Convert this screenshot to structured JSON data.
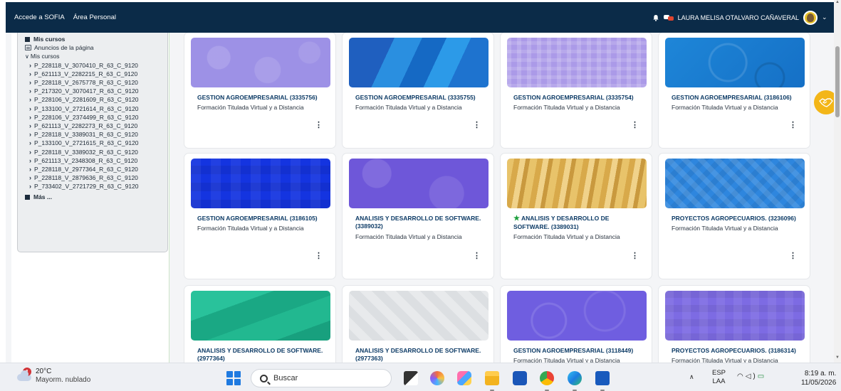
{
  "navbar": {
    "link1": "Accede a SOFIA",
    "link2": "Área Personal",
    "user_name": "LAURA MELISA OTALVARO CAÑAVERAL",
    "bg": "#0b2b48"
  },
  "drawer": {
    "my_courses_label": "Mis cursos",
    "announcements_label": "Anuncios de la página",
    "my_courses_group_label": "Mis cursos",
    "courses": [
      "P_228118_V_3070410_R_63_C_9120",
      "P_621113_V_2282215_R_63_C_9120",
      "P_228118_V_2675778_R_63_C_9120",
      "P_217320_V_3070417_R_63_C_9120",
      "P_228106_V_2281609_R_63_C_9120",
      "P_133100_V_2721614_R_63_C_9120",
      "P_228106_V_2374499_R_63_C_9120",
      "P_621113_V_2282273_R_63_C_9120",
      "P_228118_V_3389031_R_63_C_9120",
      "P_133100_V_2721615_R_63_C_9120",
      "P_228118_V_3389032_R_63_C_9120",
      "P_621113_V_2348308_R_63_C_9120",
      "P_228118_V_2977364_R_63_C_9120",
      "P_228118_V_2879636_R_63_C_9120",
      "P_733402_V_2721729_R_63_C_9120"
    ],
    "more_label": "Más ..."
  },
  "cards": [
    {
      "title": "GESTION AGROEMPRESARIAL (3335756)",
      "subtitle": "Formación Titulada Virtual y a Distancia",
      "menu": "⋮",
      "starred": false
    },
    {
      "title": "GESTION AGROEMPRESARIAL (3335755)",
      "subtitle": "Formación Titulada Virtual y a Distancia",
      "menu": "⋮",
      "starred": false
    },
    {
      "title": "GESTION AGROEMPRESARIAL (3335754)",
      "subtitle": "Formación Titulada Virtual y a Distancia",
      "menu": "⋮",
      "starred": false
    },
    {
      "title": "GESTION AGROEMPRESARIAL (3186106)",
      "subtitle": "Formación Titulada Virtual y a Distancia",
      "menu": "⋮",
      "starred": false
    },
    {
      "title": "GESTION AGROEMPRESARIAL (3186105)",
      "subtitle": "Formación Titulada Virtual y a Distancia",
      "menu": "⋮",
      "starred": false
    },
    {
      "title": "ANALISIS Y DESARROLLO DE SOFTWARE. (3389032)",
      "subtitle": "Formación Titulada Virtual y a Distancia",
      "menu": "⋮",
      "starred": false
    },
    {
      "title": "ANALISIS Y DESARROLLO DE SOFTWARE. (3389031)",
      "subtitle": "Formación Titulada Virtual y a Distancia",
      "menu": "⋮",
      "starred": true,
      "star_glyph": "★"
    },
    {
      "title": "PROYECTOS AGROPECUARIOS. (3236096)",
      "subtitle": "Formación Titulada Virtual y a Distancia",
      "menu": "⋮",
      "starred": false
    },
    {
      "title": "ANALISIS Y DESARROLLO DE SOFTWARE. (2977364)",
      "subtitle": "",
      "menu": "",
      "starred": false
    },
    {
      "title": "ANALISIS Y DESARROLLO DE SOFTWARE. (2977363)",
      "subtitle": "",
      "menu": "",
      "starred": false
    },
    {
      "title": "GESTION AGROEMPRESARIAL (3118449)",
      "subtitle": "Formación Titulada Virtual y a Distancia",
      "menu": "",
      "starred": false
    },
    {
      "title": "PROYECTOS AGROPECUARIOS. (3186314)",
      "subtitle": "Formación Titulada Virtual y a Distancia",
      "menu": "",
      "starred": false
    }
  ],
  "taskbar": {
    "weather_temp": "20°C",
    "weather_desc": "Mayorm. nublado",
    "weather_badge": "1",
    "search_placeholder": "Buscar",
    "lang_line1": "ESP",
    "lang_line2": "LAA",
    "time": "8:19 a. m.",
    "date": "11/05/2026"
  },
  "colors": {
    "card_title": "#0d3b66",
    "accent_help": "#f3b618"
  }
}
